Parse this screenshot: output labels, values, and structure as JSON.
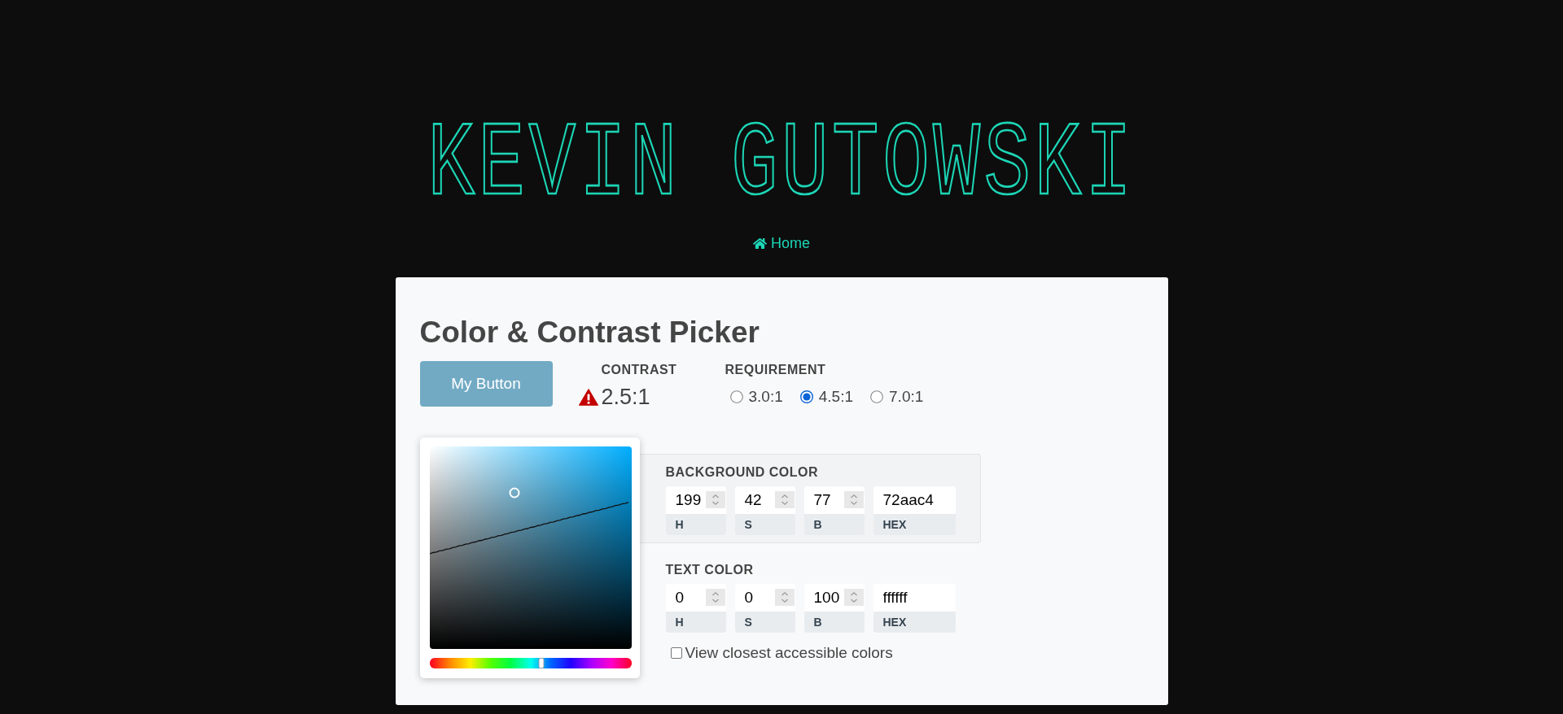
{
  "header": {
    "logo": "KEVIN GUTOWSKI",
    "nav": [
      {
        "label": "Home"
      }
    ]
  },
  "card": {
    "title": "Color & Contrast Picker",
    "preview_button": {
      "label": "My Button"
    },
    "contrast": {
      "label": "CONTRAST",
      "value": "2.5:1",
      "passes": false
    },
    "requirement": {
      "label": "REQUIREMENT",
      "options": [
        {
          "label": "3.0:1",
          "selected": false
        },
        {
          "label": "4.5:1",
          "selected": true
        },
        {
          "label": "7.0:1",
          "selected": false
        }
      ]
    },
    "picker": {
      "hue_slider": {
        "level": 0.553
      }
    },
    "color_sections": [
      {
        "label": "BACKGROUND COLOR",
        "selected": true,
        "fields": [
          {
            "kind": "number",
            "label": "H",
            "value": "199"
          },
          {
            "kind": "number",
            "label": "S",
            "value": "42"
          },
          {
            "kind": "number",
            "label": "B",
            "value": "77"
          },
          {
            "kind": "text",
            "label": "HEX",
            "value": "72aac4"
          }
        ]
      },
      {
        "label": "TEXT COLOR",
        "selected": false,
        "fields": [
          {
            "kind": "number",
            "label": "H",
            "value": "0"
          },
          {
            "kind": "number",
            "label": "S",
            "value": "0"
          },
          {
            "kind": "number",
            "label": "B",
            "value": "100"
          },
          {
            "kind": "text",
            "label": "HEX",
            "value": "ffffff"
          }
        ]
      }
    ],
    "closest_colors": {
      "label": "View closest accessible colors",
      "checked": false
    }
  }
}
